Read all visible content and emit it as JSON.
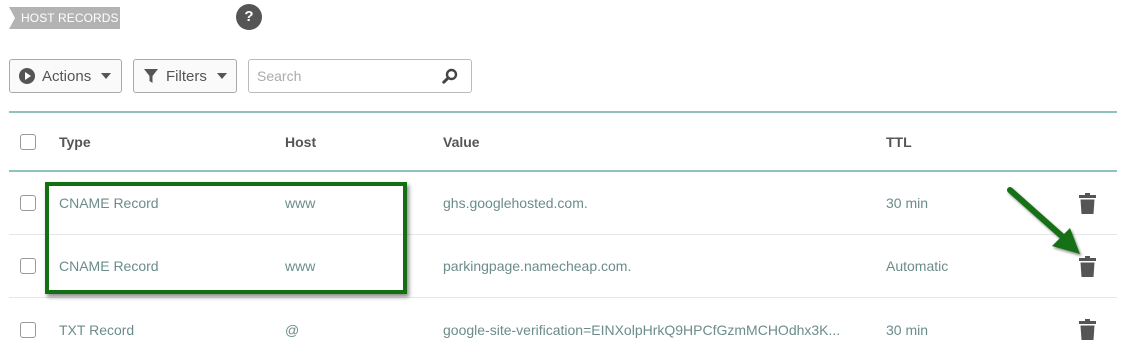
{
  "section": {
    "title": "HOST RECORDS",
    "help_label": "?"
  },
  "toolbar": {
    "actions_label": "Actions",
    "filters_label": "Filters",
    "search_placeholder": "Search",
    "search_value": ""
  },
  "table": {
    "headers": {
      "type": "Type",
      "host": "Host",
      "value": "Value",
      "ttl": "TTL"
    },
    "rows": [
      {
        "type": "CNAME Record",
        "host": "www",
        "value": "ghs.googlehosted.com.",
        "ttl": "30 min"
      },
      {
        "type": "CNAME Record",
        "host": "www",
        "value": "parkingpage.namecheap.com.",
        "ttl": "Automatic"
      },
      {
        "type": "TXT Record",
        "host": "@",
        "value": "google-site-verification=EINXolpHrkQ9HPCfGzmMCHOdhx3K...",
        "ttl": "30 min"
      }
    ]
  },
  "colors": {
    "header_rule": "#8fc1bd",
    "row_text": "#6b8c8a",
    "annotation": "#137012"
  },
  "icons": [
    "help-icon",
    "play-circle-icon",
    "filter-icon",
    "search-icon",
    "trash-icon",
    "annotation-arrow"
  ]
}
